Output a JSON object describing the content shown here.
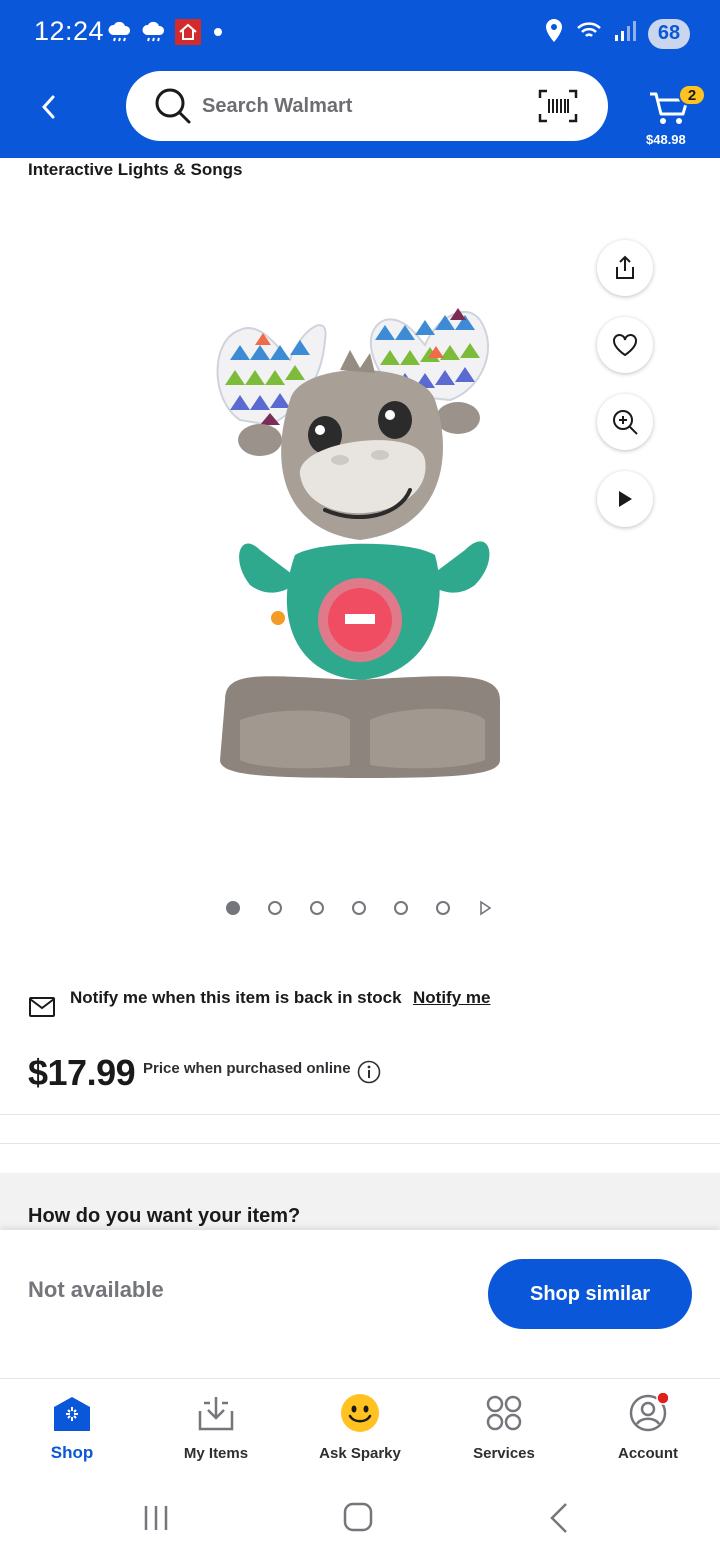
{
  "status_bar": {
    "time": "12:24",
    "battery": "68",
    "icons_left": [
      "rain-cloud-icon",
      "rain-cloud-icon",
      "home-alert-icon",
      "dot-icon"
    ],
    "icons_right": [
      "location-icon",
      "wifi-icon",
      "signal-icon",
      "battery-icon"
    ]
  },
  "header": {
    "search_placeholder": "Search Walmart",
    "cart_count": "2",
    "cart_total": "$48.98"
  },
  "product": {
    "subtitle": "Interactive Lights & Songs",
    "image_name": "moose-toy",
    "gallery_count": 6,
    "gallery_active": 1,
    "actions": [
      "share-icon",
      "heart-icon",
      "zoom-in-icon",
      "play-icon"
    ]
  },
  "notify": {
    "text": "Notify me when this item is back in stock",
    "link": "Notify me"
  },
  "pricing": {
    "price": "$17.99",
    "note": "Price when purchased online"
  },
  "fulfillment": {
    "heading": "How do you want your item?",
    "status": "Not available",
    "cta": "Shop similar"
  },
  "tabs": [
    {
      "label": "Shop",
      "icon": "shop-icon",
      "active": true
    },
    {
      "label": "My Items",
      "icon": "my-items-icon",
      "active": false
    },
    {
      "label": "Ask Sparky",
      "icon": "sparky-icon",
      "active": false
    },
    {
      "label": "Services",
      "icon": "services-icon",
      "active": false
    },
    {
      "label": "Account",
      "icon": "account-icon",
      "active": false
    }
  ],
  "colors": {
    "brand_blue": "#0a57d9",
    "badge_yellow": "#ffc220",
    "notification_red": "#e0201b"
  }
}
